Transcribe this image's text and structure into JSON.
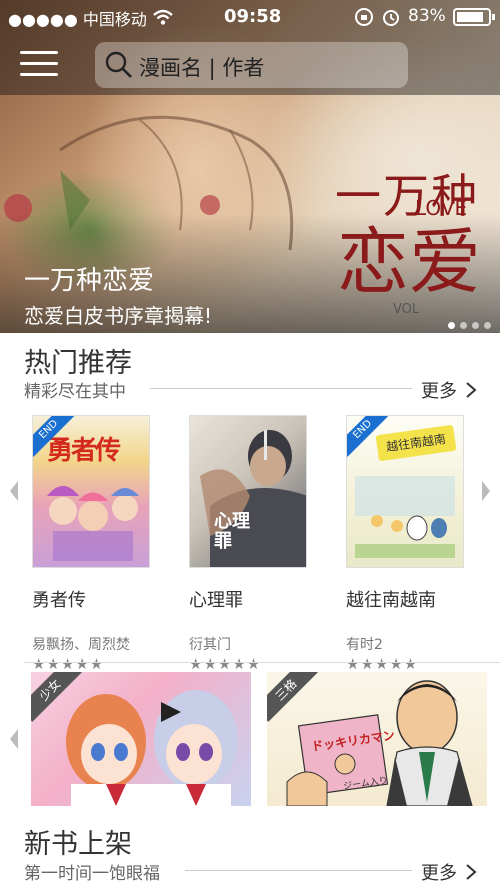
{
  "status_bar": {
    "carrier": "●●●●● 中国移动",
    "time": "09:58",
    "battery": "83%",
    "icons": [
      "wifi-icon",
      "orientation-lock-icon",
      "alarm-icon",
      "battery-icon"
    ]
  },
  "nav": {
    "menu_icon": "hamburger-menu-icon",
    "search": {
      "placeholder": "漫画名 | 作者",
      "icon": "search-icon"
    }
  },
  "hero": {
    "title": "一万种恋爱",
    "subtitle": "恋爱白皮书序章揭幕!",
    "art_title_line1": "一万种",
    "art_title_line2": "恋爱",
    "art_love": "LOVE",
    "art_vol": "VOL",
    "pager": {
      "count": 4,
      "active": 0
    }
  },
  "hot": {
    "title": "热门推荐",
    "subtitle": "精彩尽在其中",
    "more": "更多",
    "books": [
      {
        "name": "勇者传",
        "author": "易飘扬、周烈焚",
        "stars": "★★★★★",
        "badge": "END",
        "cover_text": "勇者传"
      },
      {
        "name": "心理罪",
        "author": "衍其门",
        "stars": "★★★★★",
        "badge": "",
        "cover_text": "心理罪"
      },
      {
        "name": "越往南越南",
        "author": "有时2",
        "stars": "★★★★★",
        "badge": "END",
        "cover_text": "越往南越南"
      }
    ],
    "banners": [
      {
        "tag": "少女"
      },
      {
        "tag": "三格",
        "sign_text": "ドッキリカマン",
        "sign_sub": "ジーム入り"
      }
    ]
  },
  "new_books": {
    "title": "新书上架",
    "subtitle": "第一时间一饱眼福",
    "more": "更多"
  },
  "colors": {
    "badge_blue": "#1a6fd0",
    "art_red": "#8b1a1a",
    "tag_gray": "#555555"
  }
}
